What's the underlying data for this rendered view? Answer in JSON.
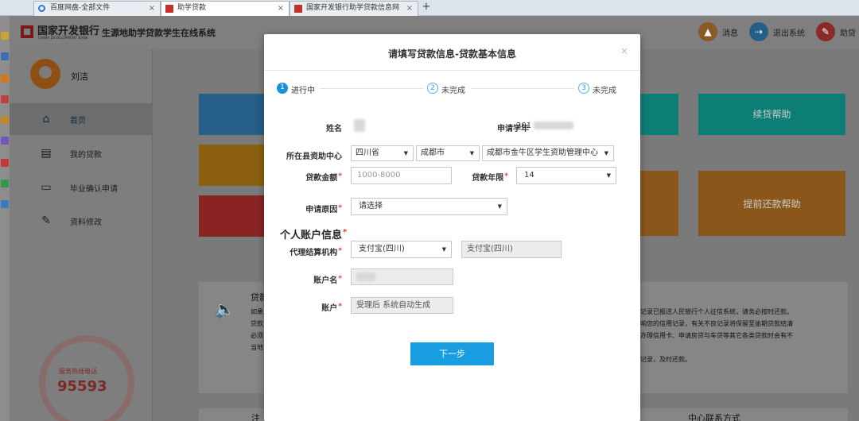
{
  "browser": {
    "tabs": [
      {
        "label": "百度网盘-全部文件",
        "active": false
      },
      {
        "label": "助学贷款",
        "active": true
      },
      {
        "label": "国家开发银行助学贷款信息网",
        "active": false
      }
    ],
    "new_tab": "+",
    "close_glyph": "×"
  },
  "header": {
    "brand": "国家开发银行",
    "brand_sub": "CHINA DEVELOPMENT BANK",
    "system_title": "生源地助学贷款学生在线系统",
    "message_label": "消息",
    "logout_label": "退出系统",
    "help_label": "助贷"
  },
  "sidebar": {
    "user_name": "刘洁",
    "items": [
      {
        "label": "首页",
        "icon": "home-icon",
        "active": true
      },
      {
        "label": "我的贷款",
        "icon": "document-icon",
        "active": false
      },
      {
        "label": "毕业确认申请",
        "icon": "monitor-icon",
        "active": false
      },
      {
        "label": "资料修改",
        "icon": "edit-icon",
        "active": false
      }
    ],
    "hotline_label": "服务热线电话",
    "hotline_number": "95593"
  },
  "main": {
    "tiles": [
      {
        "label": "续贷帮助",
        "color": "#0d7e76"
      },
      {
        "label": "提前还款帮助",
        "color": "#8a561a"
      }
    ],
    "notice": {
      "title": "贷款",
      "left_lines": [
        "如果",
        "贷款",
        "必须",
        "当地"
      ],
      "right_lines": [
        "记录已报送人民银行个人征信系统，请务必按时还款。",
        "响您的信用记录，有关不良记录将保留至逾期贷款结清",
        "办理信用卡、申请房贷与车贷等其它各类贷款时会有不",
        "",
        "记录，及时还款。"
      ]
    },
    "bottom_left": "注",
    "bottom_right": "中心联系方式"
  },
  "modal": {
    "title": "请填写贷款信息-贷款基本信息",
    "close": "×",
    "steps": [
      {
        "num": "1",
        "label": "进行中"
      },
      {
        "num": "2",
        "label": "未完成"
      },
      {
        "num": "3",
        "label": "未完成"
      }
    ],
    "labels": {
      "name": "姓名",
      "year": "申请学年",
      "center": "所在县资助中心",
      "amount": "贷款金额",
      "term": "贷款年限",
      "reason": "申请原因",
      "account_section": "个人账户信息",
      "agency": "代理结算机构",
      "account_name": "账户名",
      "account": "账户"
    },
    "values": {
      "year_prefix": "201",
      "province": "四川省",
      "city": "成都市",
      "center": "成都市金牛区学生资助管理中心",
      "amount_placeholder": "1000-8000",
      "term": "14",
      "reason": "请选择",
      "agency": "支付宝(四川)",
      "agency_readonly": "支付宝(四川)",
      "account_hint": "受理后 系统自动生成"
    },
    "next_button": "下一步"
  }
}
